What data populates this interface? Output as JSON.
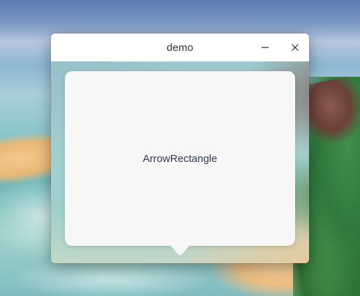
{
  "window": {
    "title": "demo",
    "controls": {
      "minimize_icon": "minimize-icon",
      "close_icon": "close-icon"
    }
  },
  "content": {
    "arrow_rectangle_label": "ArrowRectangle"
  },
  "colors": {
    "titlebar_bg": "#ffffff",
    "panel_bg": "#f7f7f7",
    "label_text": "#2f3a52"
  }
}
